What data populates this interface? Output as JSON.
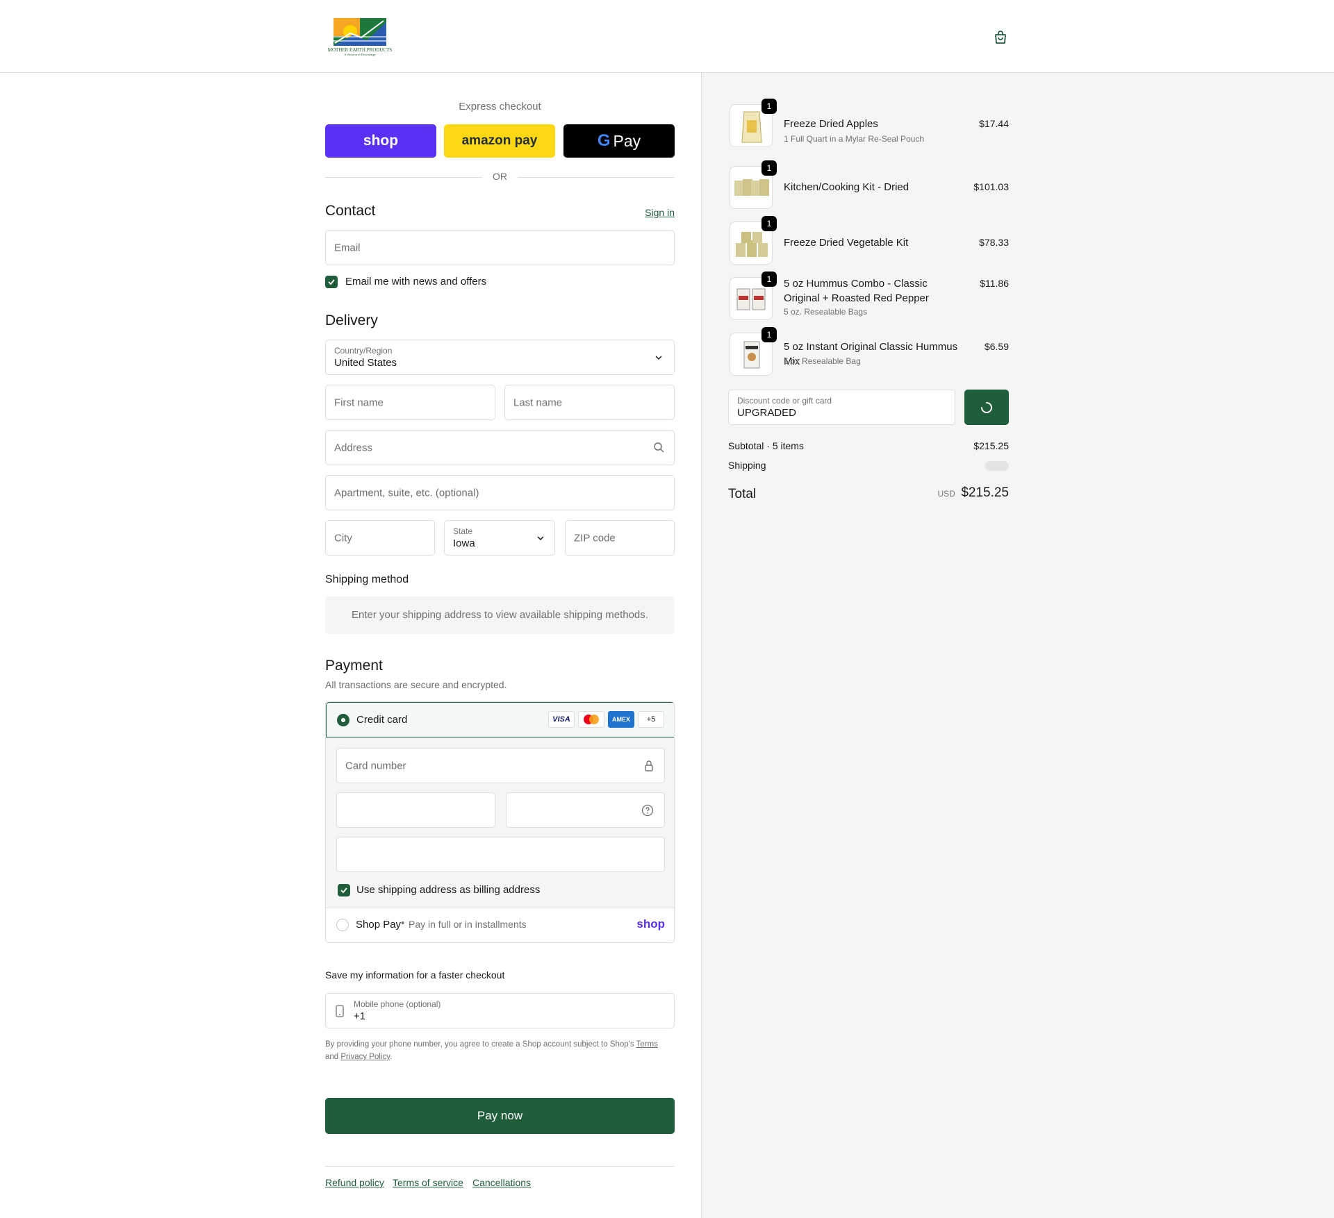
{
  "header": {
    "brand_line1": "MOTHER EARTH PRODUCTS",
    "brand_line2": "A division of Downrange"
  },
  "express": {
    "title": "Express checkout",
    "shop_label": "shop",
    "amazon_label": "amazon pay",
    "gpay_label": "Pay",
    "or_label": "OR"
  },
  "contact": {
    "heading": "Contact",
    "signin": "Sign in",
    "email_placeholder": "Email",
    "newsletter_label": "Email me with news and offers"
  },
  "delivery": {
    "heading": "Delivery",
    "country_label": "Country/Region",
    "country_value": "United States",
    "first_name_ph": "First name",
    "last_name_ph": "Last name",
    "address_ph": "Address",
    "apartment_ph": "Apartment, suite, etc. (optional)",
    "city_ph": "City",
    "state_label": "State",
    "state_value": "Iowa",
    "zip_ph": "ZIP code"
  },
  "shipping_method": {
    "heading": "Shipping method",
    "message": "Enter your shipping address to view available shipping methods."
  },
  "payment": {
    "heading": "Payment",
    "subtitle": "All transactions are secure and encrypted.",
    "credit_card_label": "Credit card",
    "cards": [
      "VISA",
      "MC",
      "AMEX"
    ],
    "more_cards": "+5",
    "card_number_ph": "Card number",
    "billing_label": "Use shipping address as billing address",
    "shoppay_label": "Shop Pay",
    "shoppay_sub": "Pay in full or in installments",
    "shoppay_brand": "shop"
  },
  "save_info": {
    "heading": "Save my information for a faster checkout",
    "phone_label": "Mobile phone (optional)",
    "phone_value": "+1",
    "legal_text": "By providing your phone number, you agree to create a Shop account subject to Shop's",
    "terms_link": "Terms",
    "and_text": "and",
    "privacy_link": "Privacy Policy",
    "period": "."
  },
  "pay_now": "Pay now",
  "footer_links": [
    "Refund policy",
    "Terms of service",
    "Cancellations"
  ],
  "cart": {
    "items": [
      {
        "qty": "1",
        "title": "Freeze Dried Apples",
        "subtitle": "1 Full Quart in a Mylar Re-Seal Pouch",
        "price": "$17.44"
      },
      {
        "qty": "1",
        "title": "Kitchen/Cooking Kit - Dried",
        "subtitle": "",
        "price": "$101.03"
      },
      {
        "qty": "1",
        "title": "Freeze Dried Vegetable Kit",
        "subtitle": "",
        "price": "$78.33"
      },
      {
        "qty": "1",
        "title": "5 oz Hummus Combo - Classic Original + Roasted Red Pepper",
        "subtitle": "5 oz. Resealable Bags",
        "price": "$11.86"
      },
      {
        "qty": "1",
        "title": "5 oz Instant Original Classic Hummus Mix",
        "subtitle": "5 oz Resealable Bag",
        "price": "$6.59"
      }
    ],
    "discount_label": "Discount code or gift card",
    "discount_value": "UPGRADED",
    "subtotal_label": "Subtotal · 5 items",
    "subtotal_value": "$215.25",
    "shipping_label": "Shipping",
    "total_label": "Total",
    "currency": "USD",
    "total_value": "$215.25"
  },
  "colors": {
    "accent": "#1f5d3b",
    "shop_purple": "#5a31f4",
    "amazon_yellow": "#ffd814"
  }
}
